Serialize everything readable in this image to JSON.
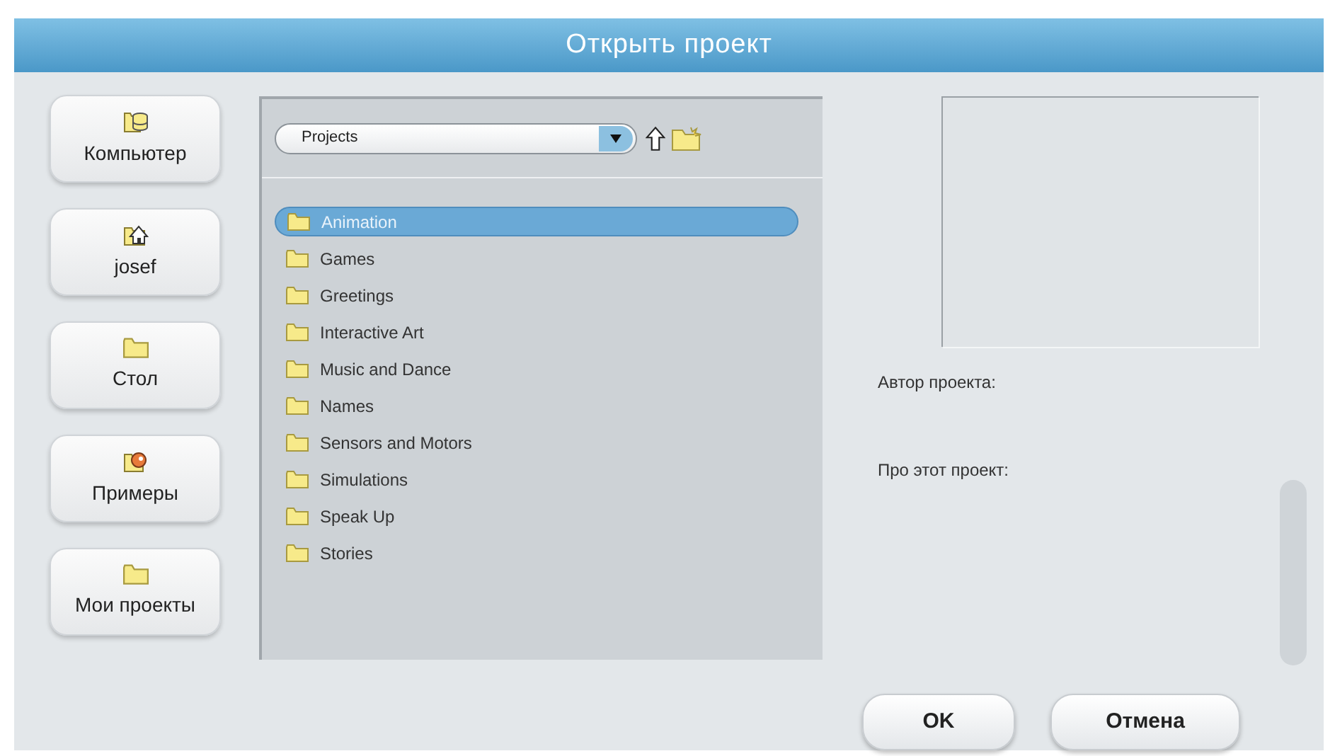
{
  "window": {
    "title": "Открыть проект"
  },
  "places": [
    {
      "label": "Компьютер",
      "kind": "drive"
    },
    {
      "label": "josef",
      "kind": "home"
    },
    {
      "label": "Стол",
      "kind": "folder"
    },
    {
      "label": "Примеры",
      "kind": "examples"
    },
    {
      "label": "Мои проекты",
      "kind": "folder"
    }
  ],
  "location": {
    "value": "Projects"
  },
  "folders": [
    {
      "name": "Animation",
      "selected": true
    },
    {
      "name": "Games",
      "selected": false
    },
    {
      "name": "Greetings",
      "selected": false
    },
    {
      "name": "Interactive Art",
      "selected": false
    },
    {
      "name": "Music and Dance",
      "selected": false
    },
    {
      "name": "Names",
      "selected": false
    },
    {
      "name": "Sensors and Motors",
      "selected": false
    },
    {
      "name": "Simulations",
      "selected": false
    },
    {
      "name": "Speak Up",
      "selected": false
    },
    {
      "name": "Stories",
      "selected": false
    }
  ],
  "details": {
    "author_label": "Автор проекта:",
    "about_label": "Про этот проект:"
  },
  "buttons": [
    {
      "label": "OK"
    },
    {
      "label": "Отмена"
    }
  ]
}
